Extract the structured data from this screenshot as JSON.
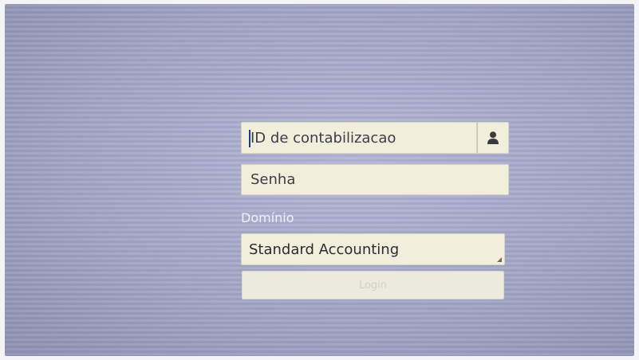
{
  "login_form": {
    "account_id": {
      "placeholder": "ID de contabilizacao",
      "icon": "user-icon"
    },
    "password": {
      "placeholder": "Senha"
    },
    "domain": {
      "label": "Domínio",
      "selected": "Standard Accounting"
    },
    "login_button": {
      "label": "Login",
      "disabled": true
    }
  },
  "colors": {
    "screen_background": "#a8aacb",
    "field_background": "#f1eedc",
    "label_text": "#eef0fb"
  }
}
